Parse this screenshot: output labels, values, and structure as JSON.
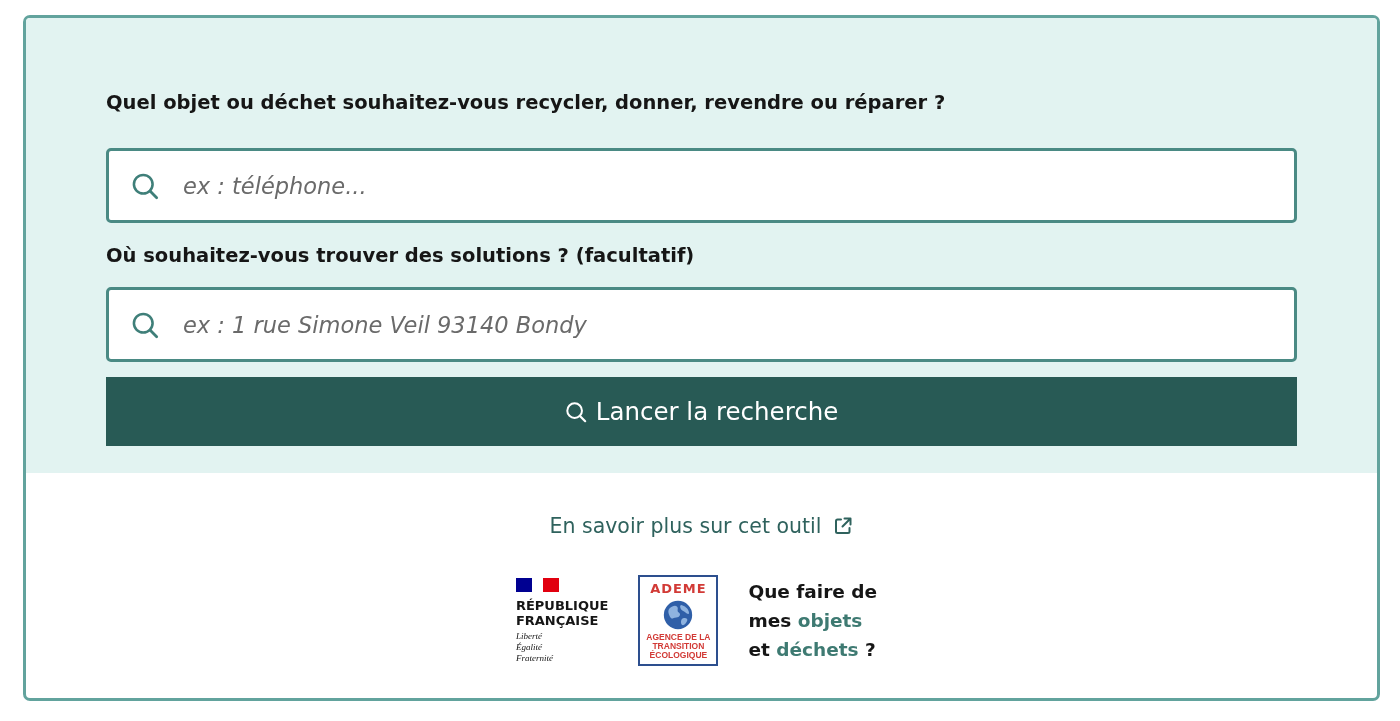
{
  "fields": [
    {
      "label": "Quel objet ou déchet souhaitez-vous recycler, donner, revendre ou réparer ?",
      "placeholder": "ex : téléphone..."
    },
    {
      "label": "Où souhaitez-vous trouver des solutions ? (facultatif)",
      "placeholder": "ex : 1 rue Simone Veil 93140 Bondy"
    }
  ],
  "search_button": {
    "label": "Lancer la recherche"
  },
  "info_link": {
    "label": "En savoir plus sur cet outil"
  },
  "logos": {
    "republique": {
      "name_lines": [
        "RÉPUBLIQUE",
        "FRANÇAISE"
      ],
      "motto_lines": [
        "Liberté",
        "Égalité",
        "Fraternité"
      ]
    },
    "ademe": {
      "name": "ADEME",
      "subtitle_lines": [
        "AGENCE DE LA",
        "TRANSITION",
        "ÉCOLOGIQUE"
      ]
    },
    "tagline_lines": [
      [
        {
          "text": "Que faire de",
          "kind": "plain"
        }
      ],
      [
        {
          "text": "mes ",
          "kind": "plain"
        },
        {
          "text": "objets",
          "kind": "highlight"
        }
      ],
      [
        {
          "text": "et ",
          "kind": "plain"
        },
        {
          "text": "déchets",
          "kind": "highlight"
        },
        {
          "text": " ?",
          "kind": "plain"
        }
      ]
    ]
  }
}
